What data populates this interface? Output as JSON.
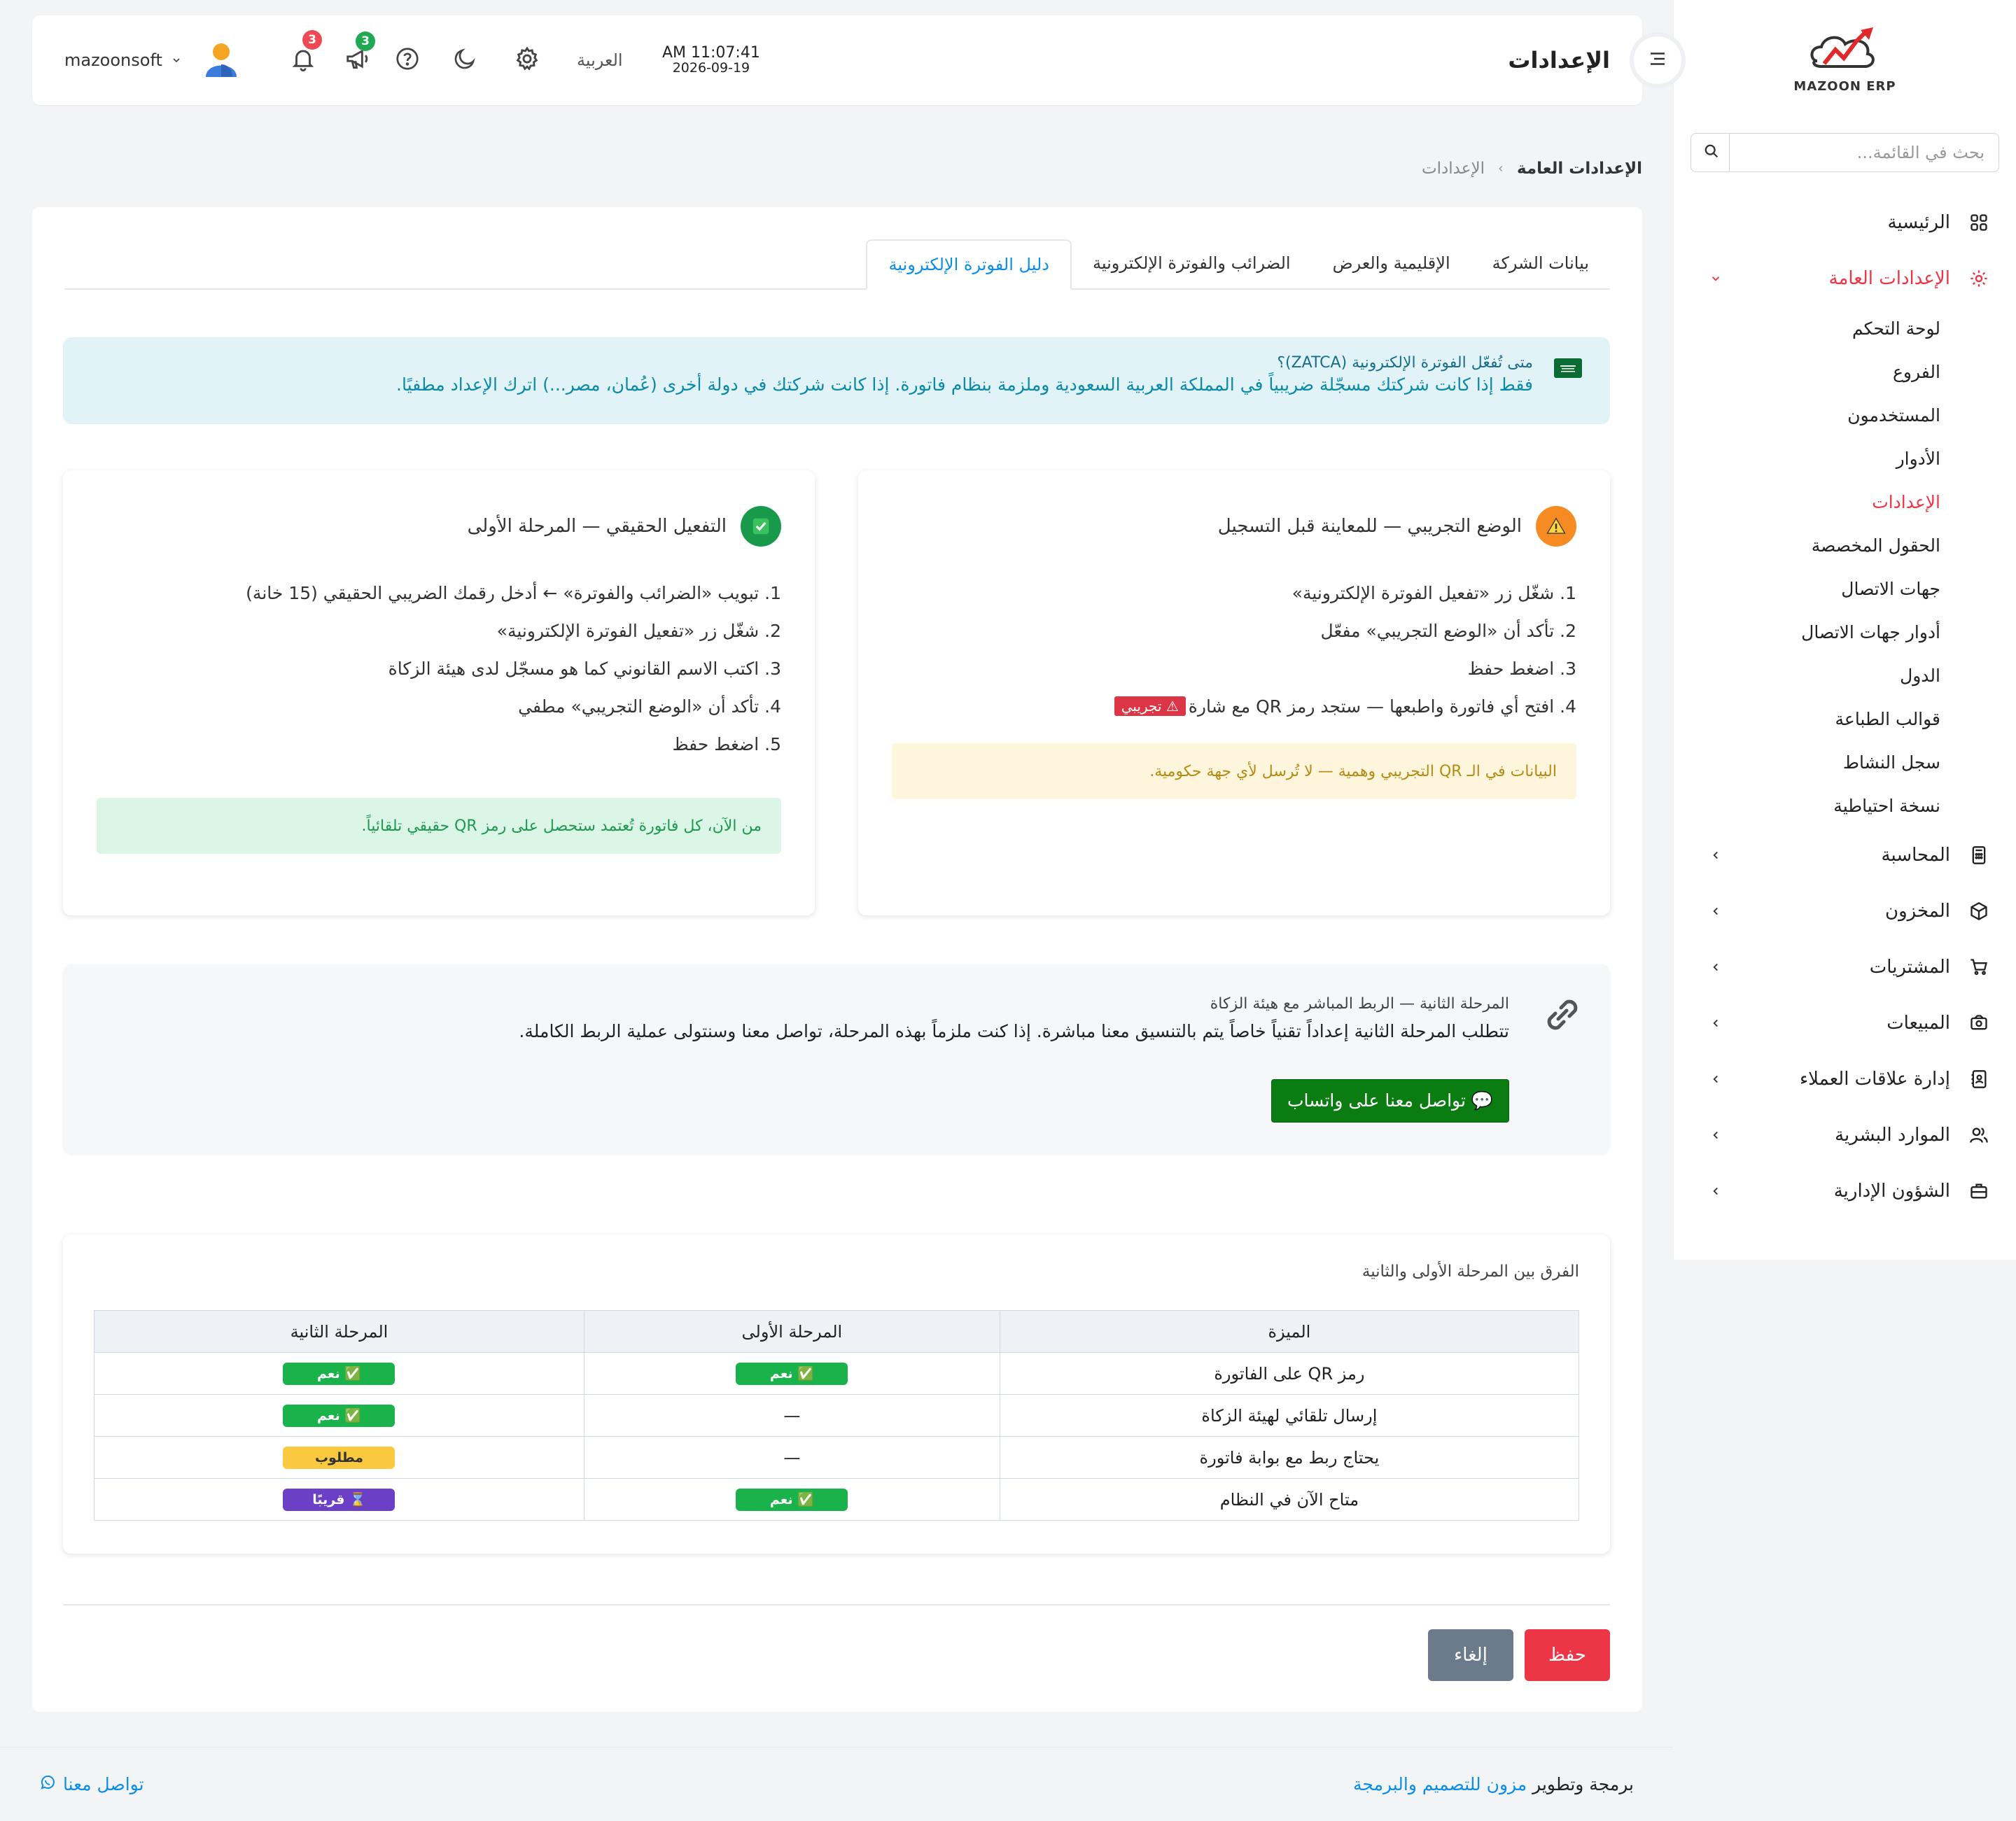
{
  "app": {
    "logo_text": "MAZOON ERP"
  },
  "topbar": {
    "title": "الإعدادات",
    "time": "AM 11:07:41",
    "date": "2026-09-19",
    "language": "العربية",
    "user_name": "mazoonsoft",
    "announcements_count": "3",
    "notifications_count": "3"
  },
  "sidebar": {
    "search_placeholder": "بحث في القائمة...",
    "menu": [
      {
        "label": "الرئيسية",
        "icon": "grid-icon"
      },
      {
        "label": "الإعدادات العامة",
        "icon": "gear-icon"
      },
      {
        "label": "المحاسبة",
        "icon": "calculator-icon"
      },
      {
        "label": "المخزون",
        "icon": "box-icon"
      },
      {
        "label": "المشتريات",
        "icon": "cart-icon"
      },
      {
        "label": "المبيعات",
        "icon": "cash-icon"
      },
      {
        "label": "إدارة علاقات العملاء",
        "icon": "contacts-icon"
      },
      {
        "label": "الموارد البشرية",
        "icon": "users-icon"
      },
      {
        "label": "الشؤون الإدارية",
        "icon": "briefcase-icon"
      }
    ],
    "submenu": [
      "لوحة التحكم",
      "الفروع",
      "المستخدمون",
      "الأدوار",
      "الإعدادات",
      "الحقول المخصصة",
      "جهات الاتصال",
      "أدوار جهات الاتصال",
      "الدول",
      "قوالب الطباعة",
      "سجل النشاط",
      "نسخة احتياطية"
    ]
  },
  "breadcrumb": {
    "current": "الإعدادات العامة",
    "parent": "الإعدادات"
  },
  "tabs": [
    "بيانات الشركة",
    "الإقليمية والعرض",
    "الضرائب والفوترة الإلكترونية",
    "دليل الفوترة الإلكترونية"
  ],
  "info_alert": {
    "question": "متى تُفعّل الفوترة الإلكترونية (ZATCA)؟",
    "text": "فقط إذا كانت شركتك مسجّلة ضريبياً في المملكة العربية السعودية وملزمة بنظام فاتورة. إذا كانت شركتك في دولة أخرى (عُمان، مصر...) اترك الإعداد مطفيًا."
  },
  "trial_mode": {
    "title": "الوضع التجريبي — للمعاينة قبل التسجيل",
    "steps": [
      "1. شغّل زر «تفعيل الفوترة الإلكترونية»",
      "2. تأكد أن «الوضع التجريبي» مفعّل",
      "3. اضغط حفظ",
      "4. افتح أي فاتورة واطبعها — ستجد رمز QR مع شارة"
    ],
    "badge": "⚠ تجريبي",
    "note": "البيانات في الـ QR التجريبي وهمية — لا تُرسل لأي جهة حكومية."
  },
  "real_mode": {
    "title": "التفعيل الحقيقي — المرحلة الأولى",
    "steps": [
      "1. تبويب «الضرائب والفوترة» ← أدخل رقمك الضريبي الحقيقي (15 خانة)",
      "2. شغّل زر «تفعيل الفوترة الإلكترونية»",
      "3. اكتب الاسم القانوني كما هو مسجّل لدى هيئة الزكاة",
      "4. تأكد أن «الوضع التجريبي» مطفي",
      "5. اضغط حفظ"
    ],
    "note": "من الآن، كل فاتورة تُعتمد ستحصل على رمز QR حقيقي تلقائياً."
  },
  "phase2": {
    "title": "المرحلة الثانية — الربط المباشر مع هيئة الزكاة",
    "body": "تتطلب المرحلة الثانية إعداداً تقنياً خاصاً يتم بالتنسيق معنا مباشرة. إذا كنت ملزماً بهذه المرحلة، تواصل معنا وسنتولى عملية الربط الكاملة.",
    "button": "💬 تواصل معنا على واتساب"
  },
  "comparison": {
    "title": "الفرق بين المرحلة الأولى والثانية",
    "headers": [
      "الميزة",
      "المرحلة الأولى",
      "المرحلة الثانية"
    ],
    "rows": [
      {
        "feature": "رمز QR على الفاتورة",
        "p1": "✅ نعم",
        "p1_type": "green",
        "p2": "✅ نعم",
        "p2_type": "green"
      },
      {
        "feature": "إرسال تلقائي لهيئة الزكاة",
        "p1": "—",
        "p1_type": "dash",
        "p2": "✅ نعم",
        "p2_type": "green"
      },
      {
        "feature": "يحتاج ربط مع بوابة فاتورة",
        "p1": "—",
        "p1_type": "dash",
        "p2": "مطلوب",
        "p2_type": "yellow"
      },
      {
        "feature": "متاح الآن في النظام",
        "p1": "✅ نعم",
        "p1_type": "green",
        "p2": "⌛ قريبًا",
        "p2_type": "purple"
      }
    ]
  },
  "actions": {
    "save": "حفظ",
    "cancel": "إلغاء"
  },
  "footer": {
    "credit_prefix": "برمجة وتطوير",
    "credit_link": "مزون للتصميم والبرمجة",
    "contact": "تواصل معنا"
  },
  "colors": {
    "accent_red": "#ed3645",
    "link_blue": "#0c8ee6",
    "whatsapp_green": "#0a7c12"
  }
}
